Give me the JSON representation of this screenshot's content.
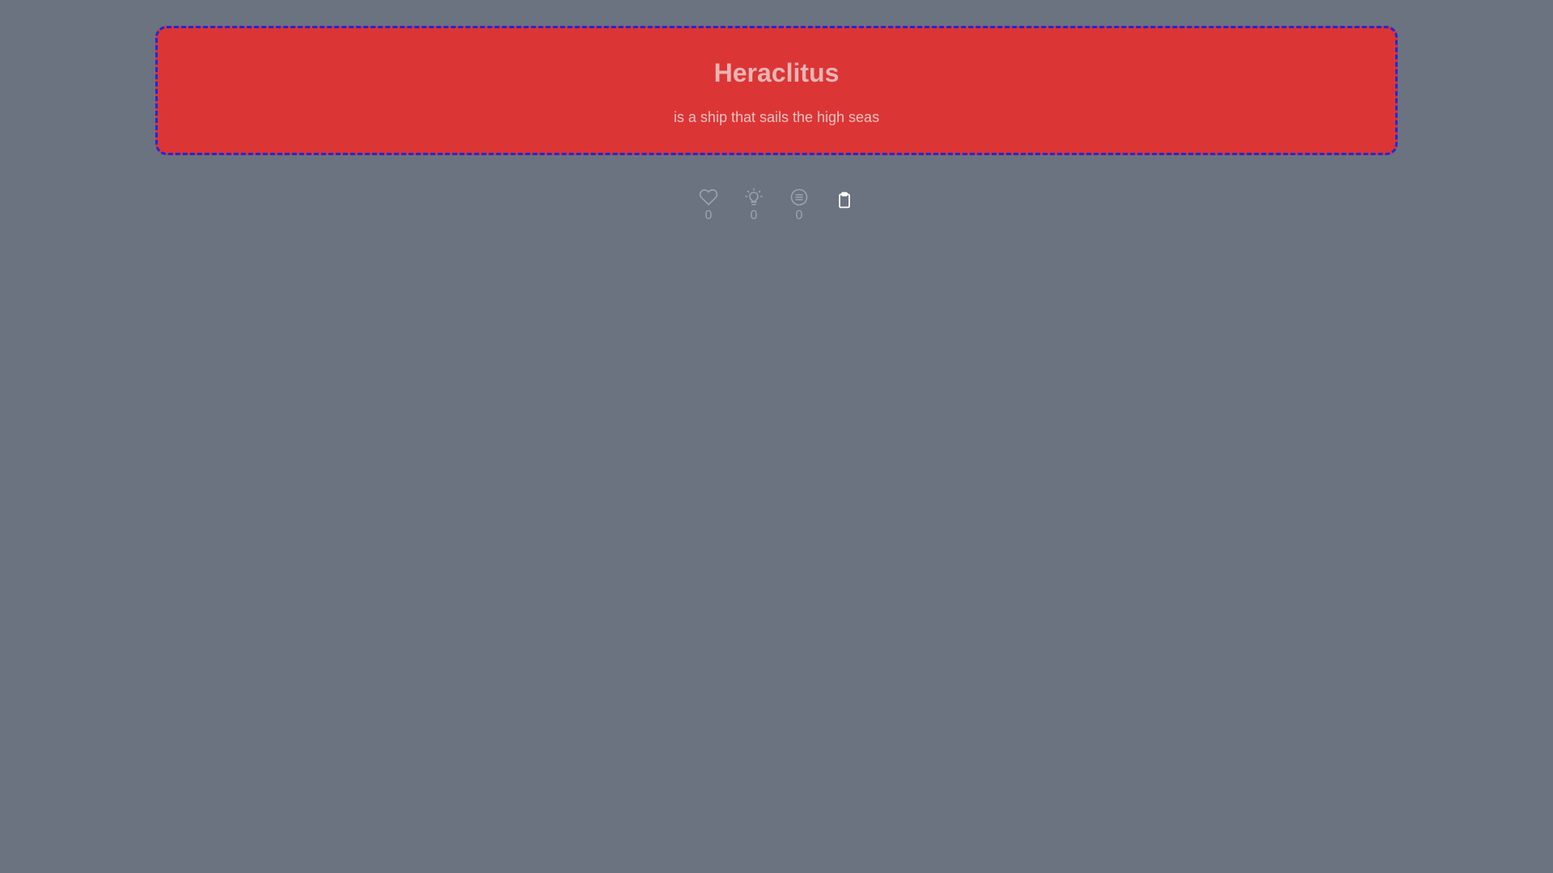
{
  "card": {
    "title": "Heraclitus",
    "subtitle": "is a ship that sails the high seas"
  },
  "actions": {
    "likes": {
      "icon": "heart-icon",
      "count": "0"
    },
    "ideas": {
      "icon": "lightbulb-icon",
      "count": "0"
    },
    "comments": {
      "icon": "list-circle-icon",
      "count": "0"
    },
    "copy": {
      "icon": "clipboard-icon"
    }
  },
  "colors": {
    "background": "#6b7280",
    "card": "#dc3535",
    "card_border": "#1d2bd8",
    "title": "#e8b4b4",
    "muted": "#9ca3af"
  }
}
